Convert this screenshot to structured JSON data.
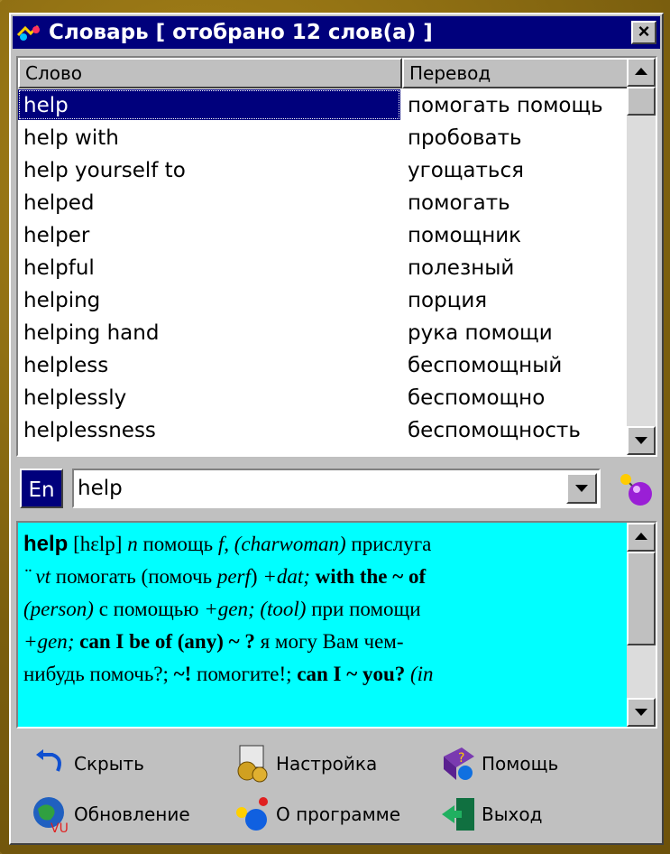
{
  "window": {
    "title": "Словарь [ отобрано 12 слов(а) ]",
    "close_label": "×"
  },
  "list": {
    "headers": {
      "word": "Слово",
      "translation": "Перевод"
    },
    "rows": [
      {
        "word": "help",
        "translation": "помогать помощь",
        "selected": true
      },
      {
        "word": "help with",
        "translation": "пробовать"
      },
      {
        "word": "help yourself to",
        "translation": "угощаться"
      },
      {
        "word": "helped",
        "translation": "помогать"
      },
      {
        "word": "helper",
        "translation": "помощник"
      },
      {
        "word": "helpful",
        "translation": "полезный"
      },
      {
        "word": "helping",
        "translation": "порция"
      },
      {
        "word": "helping hand",
        "translation": "рука помощи"
      },
      {
        "word": "helpless",
        "translation": "беспомощный"
      },
      {
        "word": "helplessly",
        "translation": "беспомощно"
      },
      {
        "word": "helplessness",
        "translation": "беспомощность"
      }
    ]
  },
  "search": {
    "lang_label": "En",
    "value": "help"
  },
  "article": {
    "headword": "help",
    "transcription": "[hɛlp]",
    "line1": " n ",
    "line1b": "помощь ",
    "line1c": "f, (charwoman) ",
    "line1d": "прислуга",
    "line2a": "¨ vt ",
    "line2b": "помогать (помочь ",
    "line2c": "perf",
    "line2d": ") ",
    "line2e": "+dat; ",
    "line2f": "with the ~ of",
    "line3a": "(person) ",
    "line3b": "с помощью ",
    "line3c": "+gen; (tool) ",
    "line3d": "при помощи",
    "line4a": "+gen; ",
    "line4b": "can I be of (any) ~ ?",
    "line4c": " я могу Вам чем-",
    "line5a": "нибудь помочь?; ",
    "line5b": "~!",
    "line5c": " помогите!; ",
    "line5d": "can I ~ you?",
    "line5e": " (in"
  },
  "toolbar": {
    "hide": "Скрыть",
    "settings": "Настройка",
    "help": "Помощь",
    "update": "Обновление",
    "about": "О программе",
    "exit": "Выход"
  },
  "colors": {
    "title_bar": "#00007c",
    "article_bg": "#00ffff",
    "window_bg": "#c0c0c0",
    "desktop": "#8b6d12"
  }
}
